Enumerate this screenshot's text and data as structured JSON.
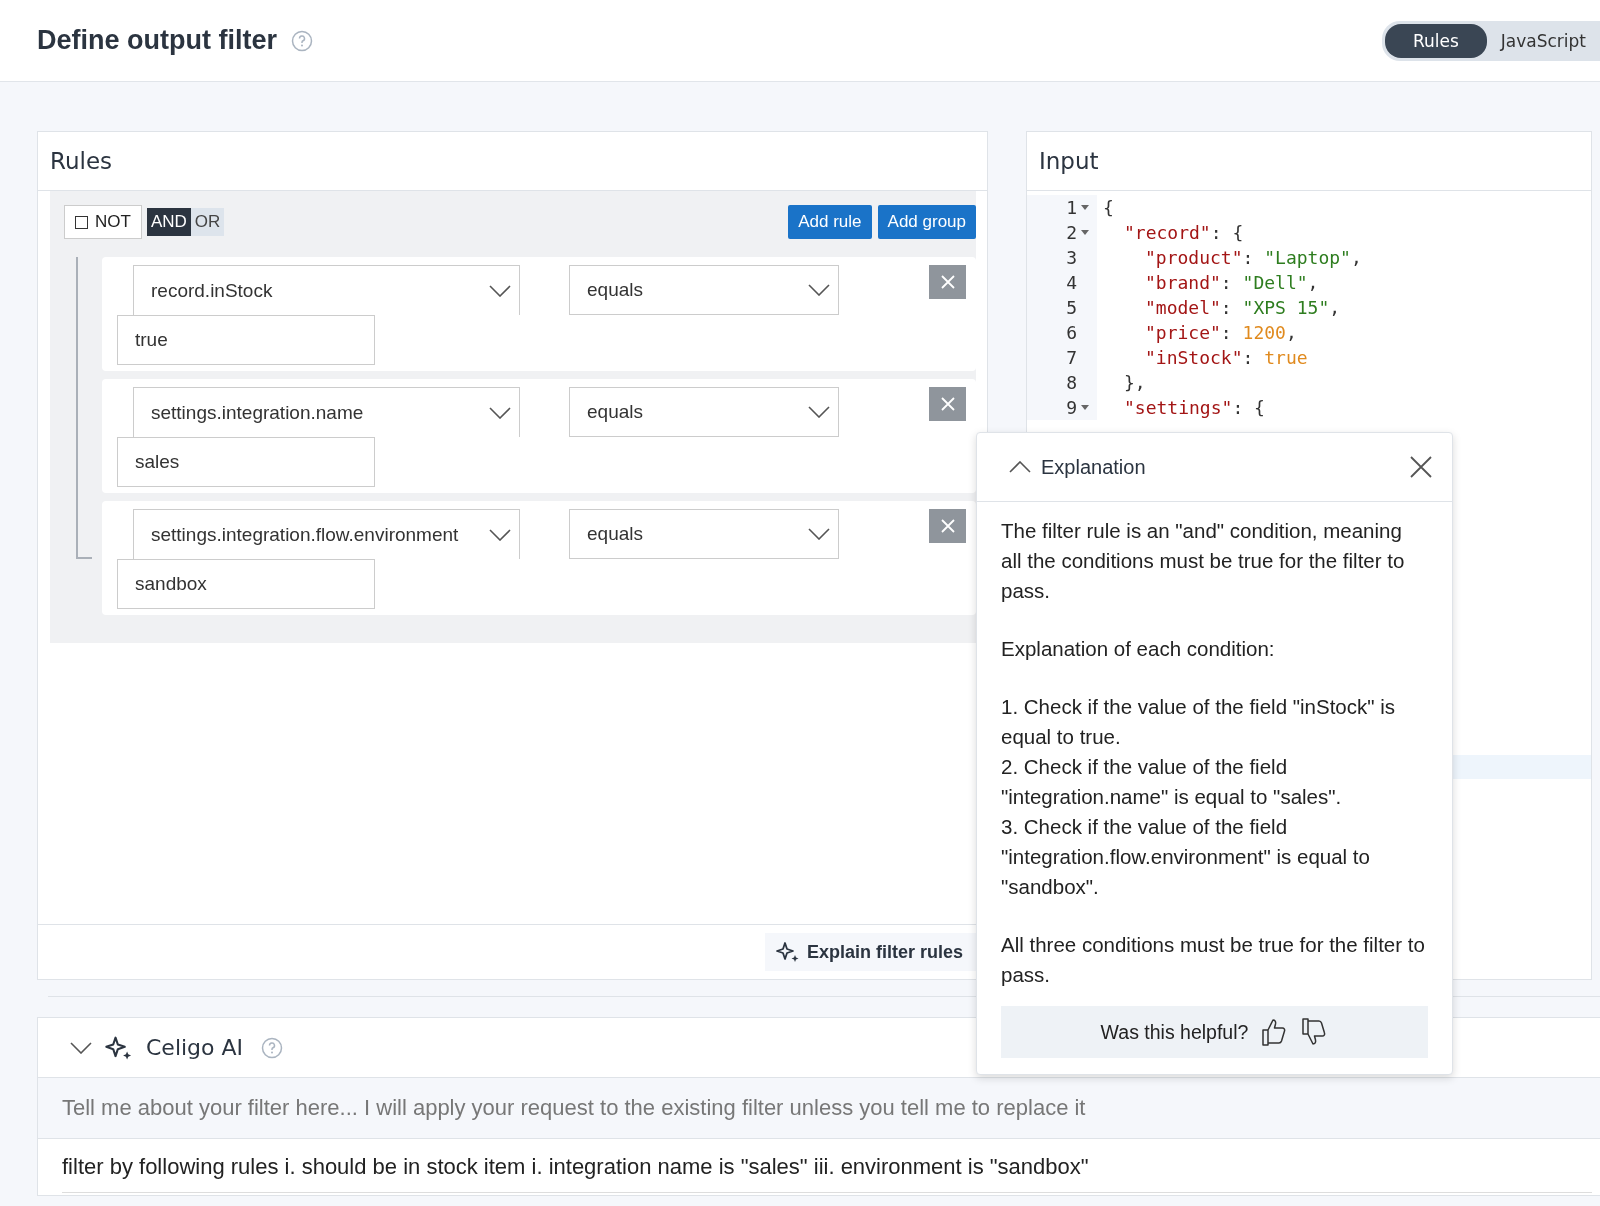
{
  "header": {
    "title": "Define output filter",
    "modes": [
      {
        "label": "Rules",
        "selected": true
      },
      {
        "label": "JavaScript",
        "selected": false
      }
    ]
  },
  "rules_panel": {
    "title": "Rules",
    "not": {
      "label": "NOT",
      "checked": false
    },
    "operators": [
      {
        "label": "AND",
        "selected": true
      },
      {
        "label": "OR",
        "selected": false
      }
    ],
    "buttons": [
      "Add rule",
      "Add group"
    ],
    "rules": [
      {
        "field": "record.inStock",
        "operator": "equals",
        "value": "true"
      },
      {
        "field": "settings.integration.name",
        "operator": "equals",
        "value": "sales"
      },
      {
        "field": "settings.integration.flow.environment",
        "operator": "equals",
        "value": "sandbox"
      }
    ],
    "explain_button": "Explain filter rules"
  },
  "input_panel": {
    "title": "Input",
    "lines": [
      {
        "number": "1",
        "fold": true,
        "tokens": [
          {
            "kind": "punct",
            "text": "{"
          }
        ]
      },
      {
        "number": "2",
        "fold": true,
        "tokens": [
          {
            "kind": "key",
            "text": "\"record\""
          },
          {
            "kind": "punct",
            "text": ": {"
          }
        ]
      },
      {
        "number": "3",
        "fold": false,
        "tokens": [
          {
            "kind": "key",
            "text": "\"product\""
          },
          {
            "kind": "punct",
            "text": ": "
          },
          {
            "kind": "string",
            "text": "\"Laptop\""
          },
          {
            "kind": "punct",
            "text": ","
          }
        ]
      },
      {
        "number": "4",
        "fold": false,
        "tokens": [
          {
            "kind": "key",
            "text": "\"brand\""
          },
          {
            "kind": "punct",
            "text": ": "
          },
          {
            "kind": "string",
            "text": "\"Dell\""
          },
          {
            "kind": "punct",
            "text": ","
          }
        ]
      },
      {
        "number": "5",
        "fold": false,
        "tokens": [
          {
            "kind": "key",
            "text": "\"model\""
          },
          {
            "kind": "punct",
            "text": ": "
          },
          {
            "kind": "string",
            "text": "\"XPS 15\""
          },
          {
            "kind": "punct",
            "text": ","
          }
        ]
      },
      {
        "number": "6",
        "fold": false,
        "tokens": [
          {
            "kind": "key",
            "text": "\"price\""
          },
          {
            "kind": "punct",
            "text": ": "
          },
          {
            "kind": "number",
            "text": "1200"
          },
          {
            "kind": "punct",
            "text": ","
          }
        ]
      },
      {
        "number": "7",
        "fold": false,
        "tokens": [
          {
            "kind": "key",
            "text": "\"inStock\""
          },
          {
            "kind": "punct",
            "text": ": "
          },
          {
            "kind": "number",
            "text": "true"
          }
        ]
      },
      {
        "number": "8",
        "fold": false,
        "tokens": [
          {
            "kind": "punct",
            "text": "},"
          }
        ]
      },
      {
        "number": "9",
        "fold": true,
        "tokens": [
          {
            "kind": "key",
            "text": "\"settings\""
          },
          {
            "kind": "punct",
            "text": ": {"
          }
        ]
      }
    ]
  },
  "ai_panel": {
    "title": "Celigo AI",
    "expanded": true,
    "placeholder": "Tell me about your filter here... I will apply your request to the existing filter unless you tell me to replace it",
    "value": "filter by following rules i. should be in stock item i. integration name is \"sales\" iii. environment is \"sandbox\""
  },
  "explanation": {
    "title": "Explanation",
    "intro": "The filter rule is an \"and\" condition, meaning all the conditions must be true for the filter to pass.",
    "heading": "Explanation of each condition:",
    "conditions": [
      "1. Check if the value of the field \"inStock\" is equal to true.",
      "2. Check if the value of the field \"integration.name\" is equal to \"sales\".",
      "3. Check if the value of the field \"integration.flow.environment\" is equal to \"sandbox\"."
    ],
    "summary": "All three conditions must be true for the filter to pass.",
    "feedback": "Was this helpful?"
  }
}
